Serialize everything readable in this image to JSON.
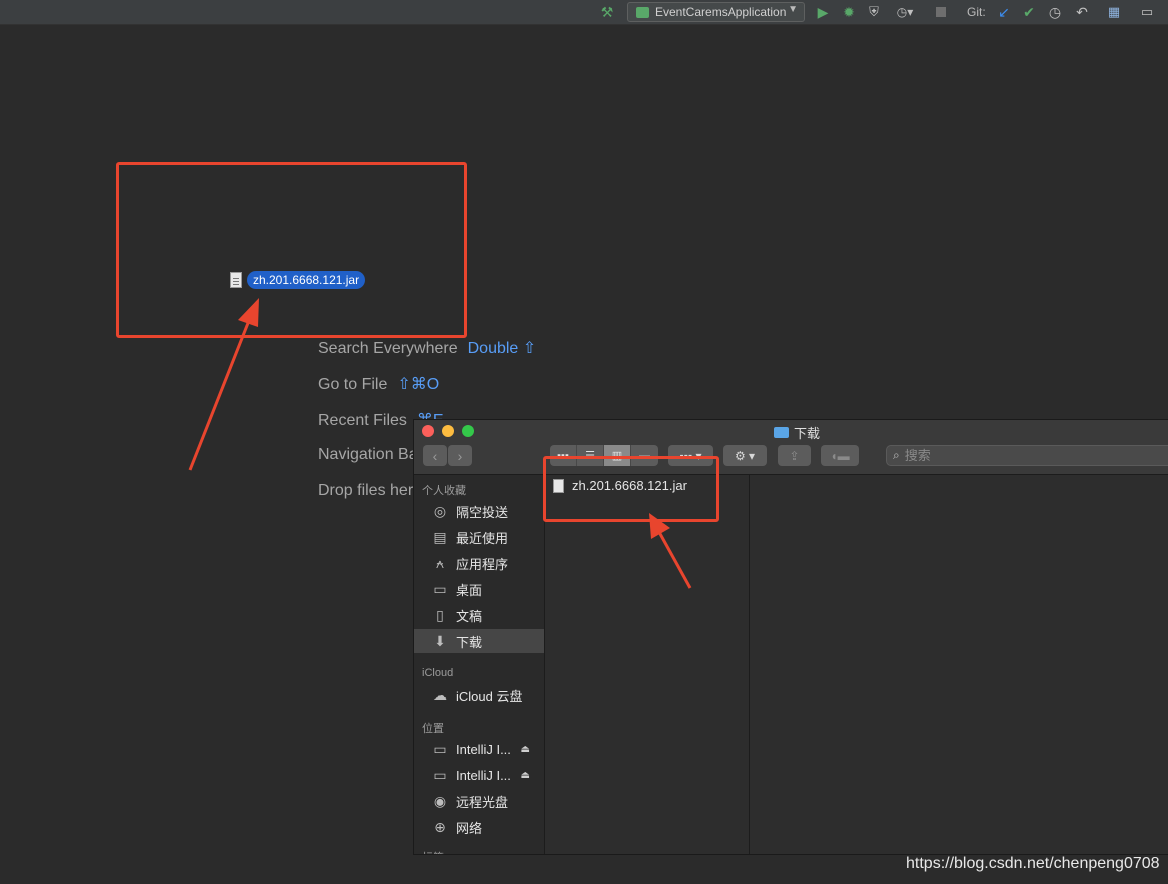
{
  "ide": {
    "run_config": "EventCaremsApplication",
    "git_label": "Git:",
    "toolbar_icons": [
      "hammer-icon",
      "run-icon",
      "debug-icon",
      "coverage-icon",
      "profile-icon",
      "stop-icon",
      "git-update-icon",
      "git-commit-icon",
      "git-history-icon",
      "git-rollback-icon",
      "project-structure-icon",
      "terminal-icon"
    ]
  },
  "welcome": {
    "hints": [
      {
        "label": "Search Everywhere",
        "key": "Double ⇧"
      },
      {
        "label": "Go to File",
        "key": "⇧⌘O"
      },
      {
        "label": "Recent Files",
        "key": "⌘E"
      },
      {
        "label": "Navigation Bar",
        "key": ""
      },
      {
        "label": "Drop files here to open",
        "key": ""
      }
    ]
  },
  "dragged_file": "zh.201.6668.121.jar",
  "finder": {
    "title": "下载",
    "search_placeholder": "搜索",
    "sections": {
      "favorites": "个人收藏",
      "icloud": "iCloud",
      "locations": "位置",
      "tags": "标签"
    },
    "favorites": [
      "隔空投送",
      "最近使用",
      "应用程序",
      "桌面",
      "文稿",
      "下载"
    ],
    "icloud_items": [
      "iCloud 云盘"
    ],
    "locations": [
      "IntelliJ I...",
      "IntelliJ I...",
      "远程光盘",
      "网络"
    ],
    "selected_item": "下载",
    "files": [
      "zh.201.6668.121.jar"
    ]
  },
  "watermark": "https://blog.csdn.net/chenpeng0708",
  "colors": {
    "accent": "#589df6",
    "annotation": "#e8452e",
    "selection": "#2060c8"
  }
}
